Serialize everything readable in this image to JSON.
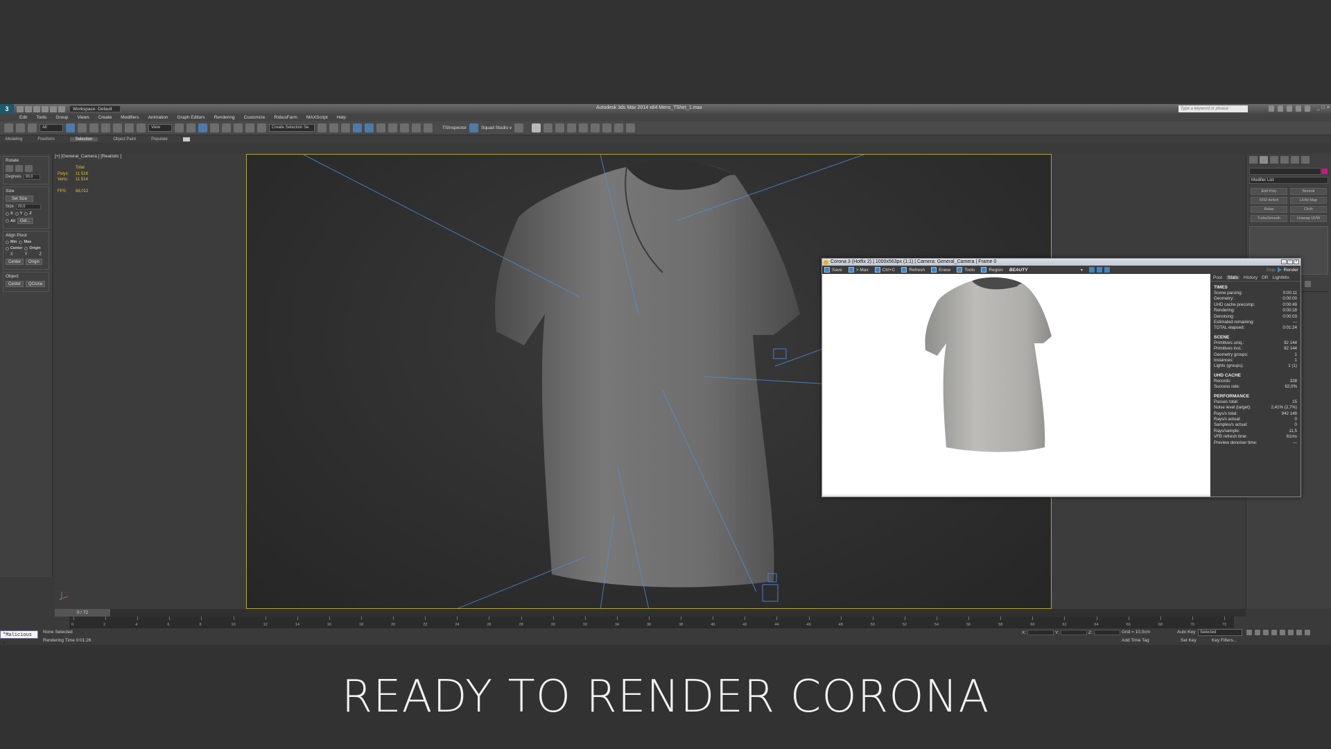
{
  "app": {
    "logo": "3",
    "workspace": "Workspace: Default",
    "title": "Autodesk 3ds Max  2014 x64    Mens_TShirt_1.max",
    "search_placeholder": "Type a keyword or phrase"
  },
  "menu": [
    "Edit",
    "Tools",
    "Group",
    "Views",
    "Create",
    "Modifiers",
    "Animation",
    "Graph Editors",
    "Rendering",
    "Customize",
    "RxbusFarm",
    "MAXScript",
    "Help"
  ],
  "toolbar": {
    "filter_value": "All",
    "refcoord_value": "View",
    "selection_set_placeholder": "Create Selection Se",
    "tsinspector_label": "TSInspector",
    "squad_label": "Squad Studio v"
  },
  "ribbon": {
    "tabs": [
      "Modeling",
      "Freeform",
      "Selection",
      "Object Paint",
      "Populate"
    ],
    "active_tab": "Selection"
  },
  "left_panel": {
    "rotate": {
      "title": "Rotate",
      "degrees_label": "Degrees",
      "degrees_value": "90,0"
    },
    "size": {
      "title": "Size",
      "set_size": "Set Size",
      "size_label": "Size",
      "size_value": "20,0",
      "axes": [
        "X",
        "Y",
        "Z"
      ],
      "all": "All",
      "get": "Get..."
    },
    "align_pivot": {
      "title": "Align Pivot",
      "min": "Min",
      "max": "Max",
      "center": "Center",
      "origin": "Origin",
      "axes": [
        "X",
        "Y",
        "Z"
      ],
      "center_btn": "Center",
      "origin_btn": "Origin"
    },
    "object": {
      "title": "Object",
      "center_btn": "Center",
      "qclone_btn": "QClone"
    }
  },
  "viewport": {
    "label": "[+] [General_Camera ] [Realistic ]",
    "stats": {
      "total_label": "Total",
      "polys_label": "Polys:",
      "polys_value": "11 518",
      "verts_label": "Verts:",
      "verts_value": "11 514",
      "fps_label": "FPS:",
      "fps_value": "68,012"
    }
  },
  "right_panel": {
    "modifier_list": "Modifier List",
    "modifier_buttons": [
      "Edit Poly",
      "Normal",
      "FFD 4x4x4",
      "UVW Map",
      "Relax",
      "Cloth",
      "TurboSmooth",
      "Unwrap UVW"
    ],
    "swatch_color": "#d60f87"
  },
  "timeline": {
    "slider_label": "0 / 72",
    "ticks": [
      "0",
      "2",
      "4",
      "6",
      "8",
      "10",
      "12",
      "14",
      "16",
      "18",
      "20",
      "22",
      "24",
      "26",
      "28",
      "30",
      "32",
      "34",
      "36",
      "38",
      "40",
      "42",
      "44",
      "46",
      "48",
      "50",
      "52",
      "54",
      "56",
      "58",
      "60",
      "62",
      "64",
      "66",
      "68",
      "70",
      "72"
    ]
  },
  "status": {
    "maxscript": "\"Malicious s",
    "selection": "None Selected",
    "render_time": "Rendering Time  0:01:26",
    "x_label": "X:",
    "y_label": "Y:",
    "z_label": "Z:",
    "grid": "Grid = 10,0cm",
    "add_time_tag": "Add Time Tag",
    "auto_key": "Auto Key",
    "selected": "Selected",
    "set_key": "Set Key",
    "key_filters": "Key Filters..."
  },
  "vfb": {
    "title": "Corona 3 (Hotfix 2) | 1000x563px (1:1) | Camera: General_Camera | Frame 0",
    "toolbar": [
      "Save",
      "> Max",
      "Ctrl+C",
      "Refresh",
      "Erase",
      "Tools",
      "Region"
    ],
    "pass": "BEAUTY",
    "stop": "Stop",
    "render": "Render",
    "tabs": [
      "Post",
      "Stats",
      "History",
      "DR",
      "LightMix"
    ],
    "active_tab": "Stats",
    "sections": [
      {
        "title": "TIMES",
        "rows": [
          [
            "Scene parsing:",
            "0:00:11"
          ],
          [
            "Geometry:",
            "0:00:00"
          ],
          [
            "UHD cache precomp:",
            "0:00:49"
          ],
          [
            "Rendering:",
            "0:00:18"
          ],
          [
            "Denoising:",
            "0:00:03"
          ],
          [
            "Estimated remaining:",
            "---"
          ],
          [
            "TOTAL elapsed:",
            "0:01:24"
          ]
        ]
      },
      {
        "title": "SCENE",
        "rows": [
          [
            "Primitives uniq.:",
            "92 144"
          ],
          [
            "Primitives inst.:",
            "92 144"
          ],
          [
            "Geometry groups:",
            "1"
          ],
          [
            "Instances:",
            "1"
          ],
          [
            "Lights (groups):",
            "1 (1)"
          ]
        ]
      },
      {
        "title": "UHD CACHE",
        "rows": [
          [
            "Records:",
            "328"
          ],
          [
            "Success rate:",
            "62,0%"
          ]
        ]
      },
      {
        "title": "PERFORMANCE",
        "rows": [
          [
            "Passes total:",
            "15"
          ],
          [
            "Noise level (target):",
            "2,41% (2,7%)"
          ],
          [
            "Rays/s total:",
            "942 148"
          ],
          [
            "Rays/s actual:",
            "0"
          ],
          [
            "Samples/s actual:",
            "0"
          ],
          [
            "Rays/sample:",
            "11,5"
          ],
          [
            "VFB refresh time:",
            "61ms"
          ],
          [
            "Preview denoiser time:",
            "---"
          ]
        ]
      }
    ]
  },
  "caption": "READY TO RENDER  CORONA"
}
